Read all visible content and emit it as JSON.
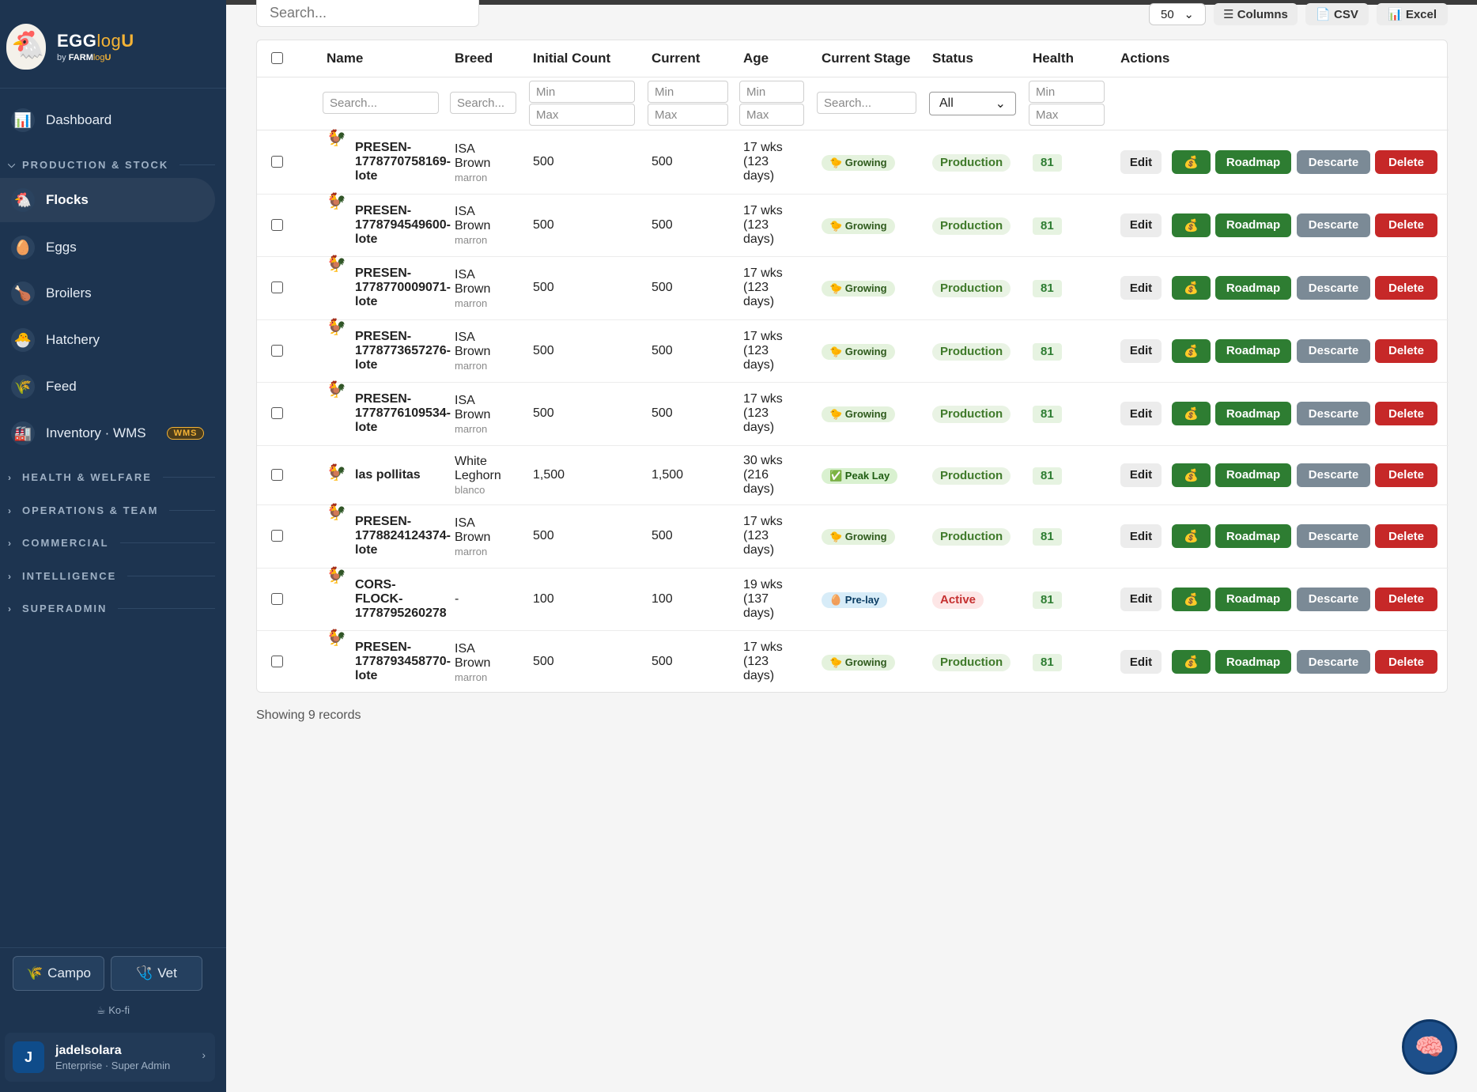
{
  "brand": {
    "title_main": "EGG",
    "title_log": "log",
    "title_u": "U",
    "sub_by": "by",
    "sub_farm": "FARM",
    "sub_log": "log",
    "sub_u": "U"
  },
  "nav": {
    "dashboard": "Dashboard",
    "section_production": "PRODUCTION & STOCK",
    "flocks": "Flocks",
    "eggs": "Eggs",
    "broilers": "Broilers",
    "hatchery": "Hatchery",
    "feed": "Feed",
    "inventory": "Inventory · WMS",
    "inventory_badge": "WMS",
    "section_health": "HEALTH & WELFARE",
    "section_operations": "OPERATIONS & TEAM",
    "section_commercial": "COMMERCIAL",
    "section_intelligence": "INTELLIGENCE",
    "section_superadmin": "SUPERADMIN"
  },
  "sidebar_footer": {
    "campo": "Campo",
    "vet": "Vet",
    "kofi": "Ko-fi"
  },
  "user": {
    "initial": "J",
    "name": "jadelsolara",
    "role": "Enterprise · Super Admin"
  },
  "toolbar": {
    "search_placeholder": "Search...",
    "per_page": "50",
    "columns": "☰ Columns",
    "csv": "📄 CSV",
    "excel": "📊 Excel"
  },
  "table": {
    "headers": {
      "name": "Name",
      "breed": "Breed",
      "initial": "Initial Count",
      "current": "Current",
      "age": "Age",
      "stage": "Current Stage",
      "status": "Status",
      "health": "Health",
      "actions": "Actions"
    },
    "filters": {
      "search": "Search...",
      "min": "Min",
      "max": "Max",
      "status_all": "All"
    },
    "actions": {
      "edit": "Edit",
      "money": "💰",
      "roadmap": "Roadmap",
      "descarte": "Descarte",
      "delete": "Delete"
    },
    "rows": [
      {
        "name": [
          "PRESEN-",
          "1778770758169-",
          "lote"
        ],
        "breed": [
          "ISA",
          "Brown"
        ],
        "color": "marron",
        "initial": "500",
        "current": "500",
        "age": [
          "17 wks",
          "(123",
          "days)"
        ],
        "stage": "🐤 Growing",
        "stage_type": "growing",
        "status": "Production",
        "status_type": "production",
        "health": "81"
      },
      {
        "name": [
          "PRESEN-",
          "1778794549600-",
          "lote"
        ],
        "breed": [
          "ISA",
          "Brown"
        ],
        "color": "marron",
        "initial": "500",
        "current": "500",
        "age": [
          "17 wks",
          "(123",
          "days)"
        ],
        "stage": "🐤 Growing",
        "stage_type": "growing",
        "status": "Production",
        "status_type": "production",
        "health": "81"
      },
      {
        "name": [
          "PRESEN-",
          "1778770009071-",
          "lote"
        ],
        "breed": [
          "ISA",
          "Brown"
        ],
        "color": "marron",
        "initial": "500",
        "current": "500",
        "age": [
          "17 wks",
          "(123",
          "days)"
        ],
        "stage": "🐤 Growing",
        "stage_type": "growing",
        "status": "Production",
        "status_type": "production",
        "health": "81"
      },
      {
        "name": [
          "PRESEN-",
          "1778773657276-",
          "lote"
        ],
        "breed": [
          "ISA",
          "Brown"
        ],
        "color": "marron",
        "initial": "500",
        "current": "500",
        "age": [
          "17 wks",
          "(123",
          "days)"
        ],
        "stage": "🐤 Growing",
        "stage_type": "growing",
        "status": "Production",
        "status_type": "production",
        "health": "81"
      },
      {
        "name": [
          "PRESEN-",
          "1778776109534-",
          "lote"
        ],
        "breed": [
          "ISA",
          "Brown"
        ],
        "color": "marron",
        "initial": "500",
        "current": "500",
        "age": [
          "17 wks",
          "(123",
          "days)"
        ],
        "stage": "🐤 Growing",
        "stage_type": "growing",
        "status": "Production",
        "status_type": "production",
        "health": "81"
      },
      {
        "name": [
          "las pollitas"
        ],
        "breed": [
          "White",
          "Leghorn"
        ],
        "color": "blanco",
        "initial": "1,500",
        "current": "1,500",
        "age": [
          "30 wks",
          "(216",
          "days)"
        ],
        "stage": "✅ Peak Lay",
        "stage_type": "peak",
        "status": "Production",
        "status_type": "production",
        "health": "81"
      },
      {
        "name": [
          "PRESEN-",
          "1778824124374-",
          "lote"
        ],
        "breed": [
          "ISA",
          "Brown"
        ],
        "color": "marron",
        "initial": "500",
        "current": "500",
        "age": [
          "17 wks",
          "(123",
          "days)"
        ],
        "stage": "🐤 Growing",
        "stage_type": "growing",
        "status": "Production",
        "status_type": "production",
        "health": "81"
      },
      {
        "name": [
          "CORS-",
          "FLOCK-",
          "1778795260278"
        ],
        "breed": [
          "-"
        ],
        "color": "",
        "initial": "100",
        "current": "100",
        "age": [
          "19 wks",
          "(137",
          "days)"
        ],
        "stage": "🥚 Pre-lay",
        "stage_type": "prelay",
        "status": "Active",
        "status_type": "active",
        "health": "81"
      },
      {
        "name": [
          "PRESEN-",
          "1778793458770-",
          "lote"
        ],
        "breed": [
          "ISA",
          "Brown"
        ],
        "color": "marron",
        "initial": "500",
        "current": "500",
        "age": [
          "17 wks",
          "(123",
          "days)"
        ],
        "stage": "🐤 Growing",
        "stage_type": "growing",
        "status": "Production",
        "status_type": "production",
        "health": "81"
      }
    ]
  },
  "footer_text": "Showing 9 records"
}
